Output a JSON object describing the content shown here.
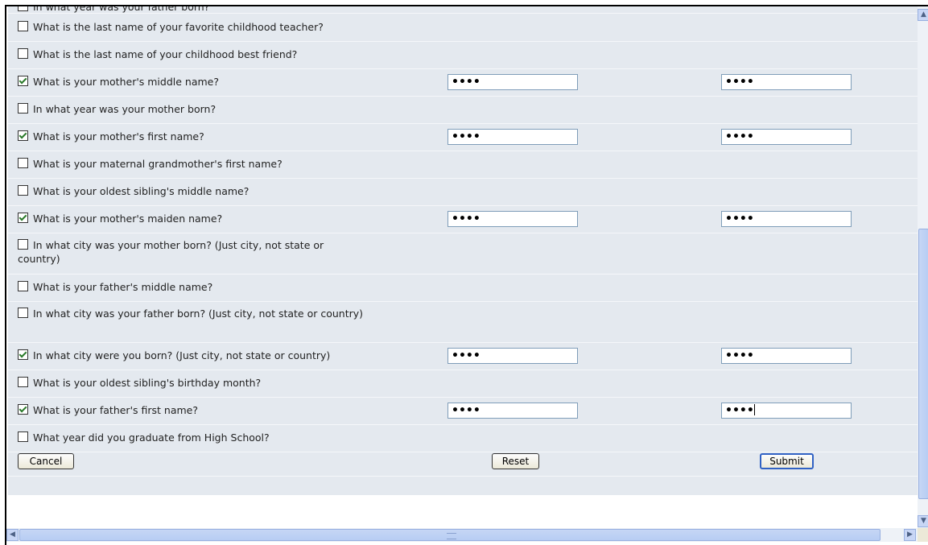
{
  "questions": [
    {
      "label": "In what year was your father born?",
      "checked": false
    },
    {
      "label": "What is the last name of your favorite childhood teacher?",
      "checked": false
    },
    {
      "label": "What is the last name of your childhood best friend?",
      "checked": false
    },
    {
      "label": "What is your mother's middle name?",
      "checked": true,
      "answer": "••••",
      "confirm": "••••"
    },
    {
      "label": "In what year was your mother born?",
      "checked": false
    },
    {
      "label": "What is your mother's first name?",
      "checked": true,
      "answer": "••••",
      "confirm": "••••"
    },
    {
      "label": "What is your maternal grandmother's first name?",
      "checked": false
    },
    {
      "label": "What is your oldest sibling's middle name?",
      "checked": false
    },
    {
      "label": "What is your mother's maiden name?",
      "checked": true,
      "answer": "••••",
      "confirm": "••••"
    },
    {
      "label": "In what city was your mother born? (Just city, not state or country)",
      "checked": false
    },
    {
      "label": "What is your father's middle name?",
      "checked": false
    },
    {
      "label": "In what city was your father born? (Just city, not state or country)",
      "checked": false
    },
    {
      "label": "In what city were you born? (Just city, not state or country)",
      "checked": true,
      "answer": "••••",
      "confirm": "••••"
    },
    {
      "label": "What is your oldest sibling's birthday month?",
      "checked": false
    },
    {
      "label": "What is your father's first name?",
      "checked": true,
      "answer": "••••",
      "confirm": "••••"
    },
    {
      "label": "What year did you graduate from High School?",
      "checked": false
    }
  ],
  "buttons": {
    "cancel": "Cancel",
    "reset": "Reset",
    "submit": "Submit"
  },
  "colors": {
    "form_background": "#e4e9ef",
    "scrollbar_thumb": "#c6d6f5",
    "focus_border": "#3162c4"
  }
}
